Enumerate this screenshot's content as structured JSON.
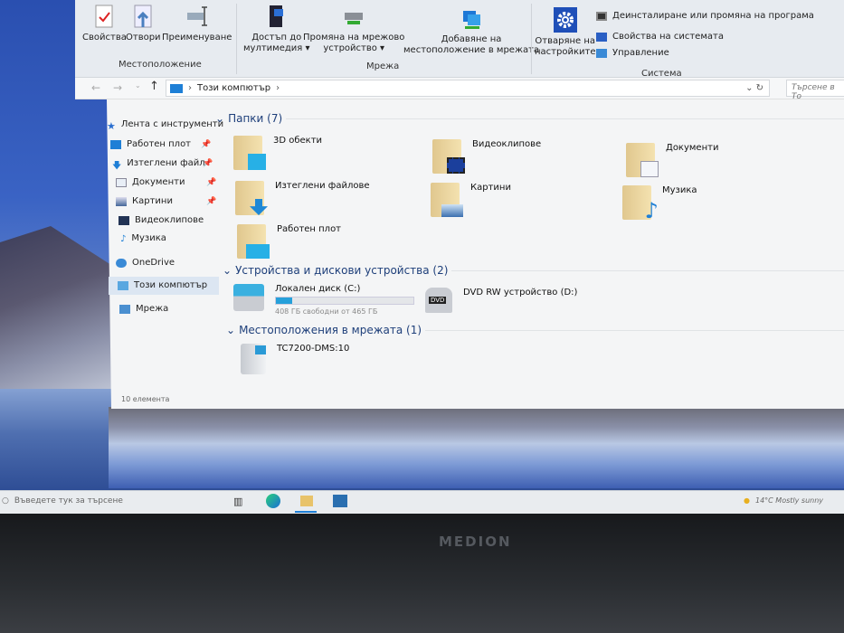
{
  "ribbon": {
    "location": {
      "group": "Местоположение",
      "properties": "Свойства",
      "open": "Отвори",
      "rename": "Преименуване"
    },
    "network": {
      "group": "Мрежа",
      "media": [
        "Достъп до",
        "мултимедия ▾"
      ],
      "map_drive": [
        "Промяна на мрежово",
        "устройство ▾"
      ],
      "add_location": [
        "Добавяне на",
        "местоположение в мрежата"
      ]
    },
    "system": {
      "group": "Система",
      "open_settings": [
        "Отваряне на",
        "настройките"
      ],
      "uninstall": "Деинсталиране или промяна на програма",
      "system_props": "Свойства на системата",
      "manage": "Управление"
    }
  },
  "address": {
    "path": "Този компютър",
    "search_placeholder": "Търсене в То"
  },
  "sidebar": [
    {
      "label": "Лента с инструменти",
      "pinned": false
    },
    {
      "label": "Работен плот",
      "pinned": true
    },
    {
      "label": "Изтеглени файл",
      "pinned": true
    },
    {
      "label": "Документи",
      "pinned": true
    },
    {
      "label": "Картини",
      "pinned": true
    },
    {
      "label": "Видеоклипове",
      "pinned": false
    },
    {
      "label": "Музика",
      "pinned": false
    },
    {
      "label": "OneDrive",
      "pinned": false
    },
    {
      "label": "Този компютър",
      "pinned": false
    },
    {
      "label": "Мрежа",
      "pinned": false
    }
  ],
  "folders": {
    "header": "Папки (7)",
    "items": [
      "3D обекти",
      "Видеоклипове",
      "Документи",
      "Изтеглени файлове",
      "Картини",
      "Музика",
      "Работен плот"
    ]
  },
  "devices": {
    "header": "Устройства и дискови устройства (2)",
    "c_drive": {
      "name": "Локален диск (C:)",
      "free": "408 ГБ свободни от 465 ГБ",
      "used_fraction": 0.12
    },
    "dvd": {
      "name": "DVD RW устройство (D:)",
      "badge": "DVD"
    }
  },
  "network_locations": {
    "header": "Местоположения в мрежата (1)",
    "items": [
      "TC7200-DMS:10"
    ]
  },
  "status": {
    "count": "10 елемента"
  },
  "taskbar": {
    "search_placeholder": "Въведете тук за търсене",
    "weather": "14°C  Mostly sunny"
  },
  "bezel": {
    "brand": "MEDION"
  },
  "colors": {
    "accent": "#1e90d6",
    "folder": "#e9d29a"
  }
}
